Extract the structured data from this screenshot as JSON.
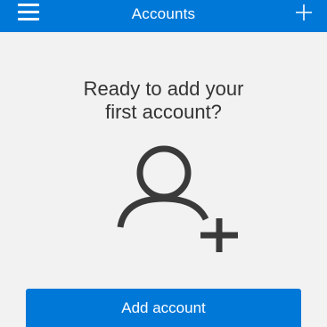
{
  "header": {
    "title": "Accounts",
    "menu_icon": "hamburger-menu-icon",
    "add_icon": "plus-icon"
  },
  "empty_state": {
    "line1": "Ready to add your",
    "line2": "first account?",
    "illustration_icon": "add-person-icon"
  },
  "actions": {
    "add_account_label": "Add account"
  },
  "colors": {
    "accent": "#0078d7",
    "background": "#f2f2f2",
    "text": "#333333"
  }
}
